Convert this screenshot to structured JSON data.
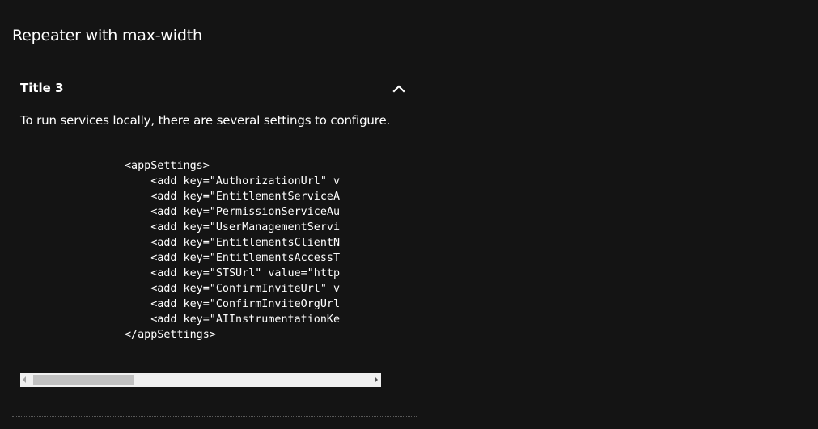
{
  "section": {
    "heading": "Repeater with max-width"
  },
  "panel": {
    "title": "Title 3",
    "expanded": true,
    "chevron_icon": "chevron-up-icon",
    "description": "To run services locally, there are several settings to configure.",
    "code_lines": [
      "                <appSettings>",
      "                    <add key=\"AuthorizationUrl\" v",
      "                    <add key=\"EntitlementServiceA",
      "                    <add key=\"PermissionServiceAu",
      "                    <add key=\"UserManagementServi",
      "                    <add key=\"EntitlementsClientN",
      "                    <add key=\"EntitlementsAccessT",
      "                    <add key=\"STSUrl\" value=\"http",
      "                    <add key=\"ConfirmInviteUrl\" v",
      "                    <add key=\"ConfirmInviteOrgUrl",
      "                    <add key=\"AIInstrumentationKe",
      "                </appSettings>"
    ],
    "scrollbar": {
      "left_arrow_icon": "scroll-left-arrow-icon",
      "right_arrow_icon": "scroll-right-arrow-icon",
      "position": 0.05
    }
  },
  "colors": {
    "background": "#141414",
    "text": "#ffffff",
    "scrollbar_track": "#f0f0f0",
    "scrollbar_thumb": "#c1c1c1",
    "divider": "#5a5a5a"
  }
}
